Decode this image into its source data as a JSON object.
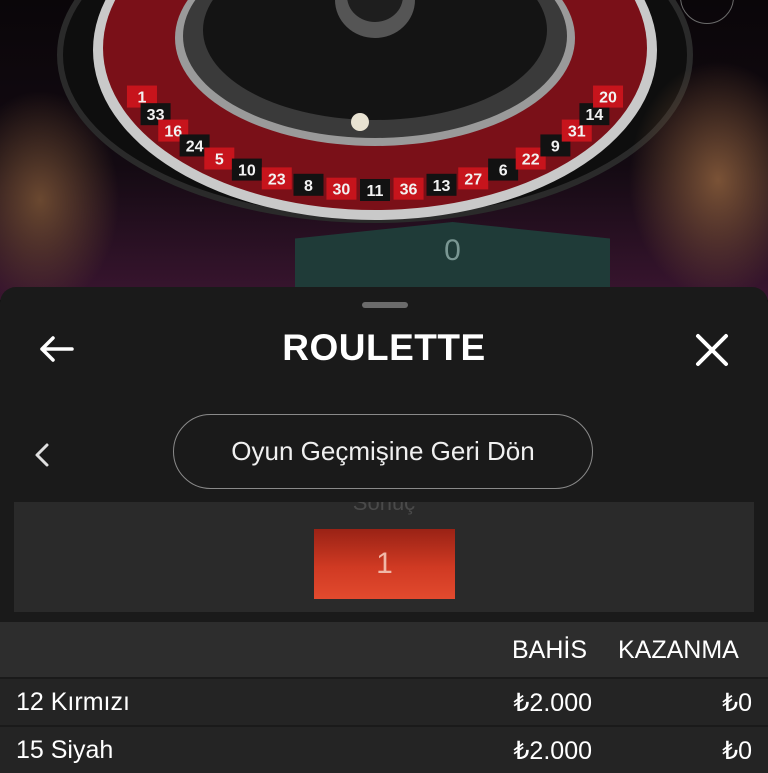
{
  "wheel": {
    "pocket_numbers": [
      "1",
      "33",
      "16",
      "24",
      "5",
      "10",
      "23",
      "8",
      "30",
      "11",
      "36",
      "13",
      "27",
      "6",
      "22",
      "9",
      "31",
      "14",
      "20"
    ],
    "result_marker": "0"
  },
  "sheet": {
    "title": "ROULETTE",
    "history_button_label": "Oyun Geçmişine Geri Dön",
    "result_label": "Sonuç",
    "result_value": "1"
  },
  "table": {
    "columns": {
      "bet": "BAHİS",
      "win": "KAZANMA"
    },
    "rows": [
      {
        "label": "12 Kırmızı",
        "bet": "₺2.000",
        "win": "₺0"
      },
      {
        "label": "15 Siyah",
        "bet": "₺2.000",
        "win": "₺0"
      }
    ]
  },
  "colors": {
    "sheet_bg": "#1a1a1a",
    "result_red": "#d03a23",
    "zero_green": "#1f3b38"
  }
}
